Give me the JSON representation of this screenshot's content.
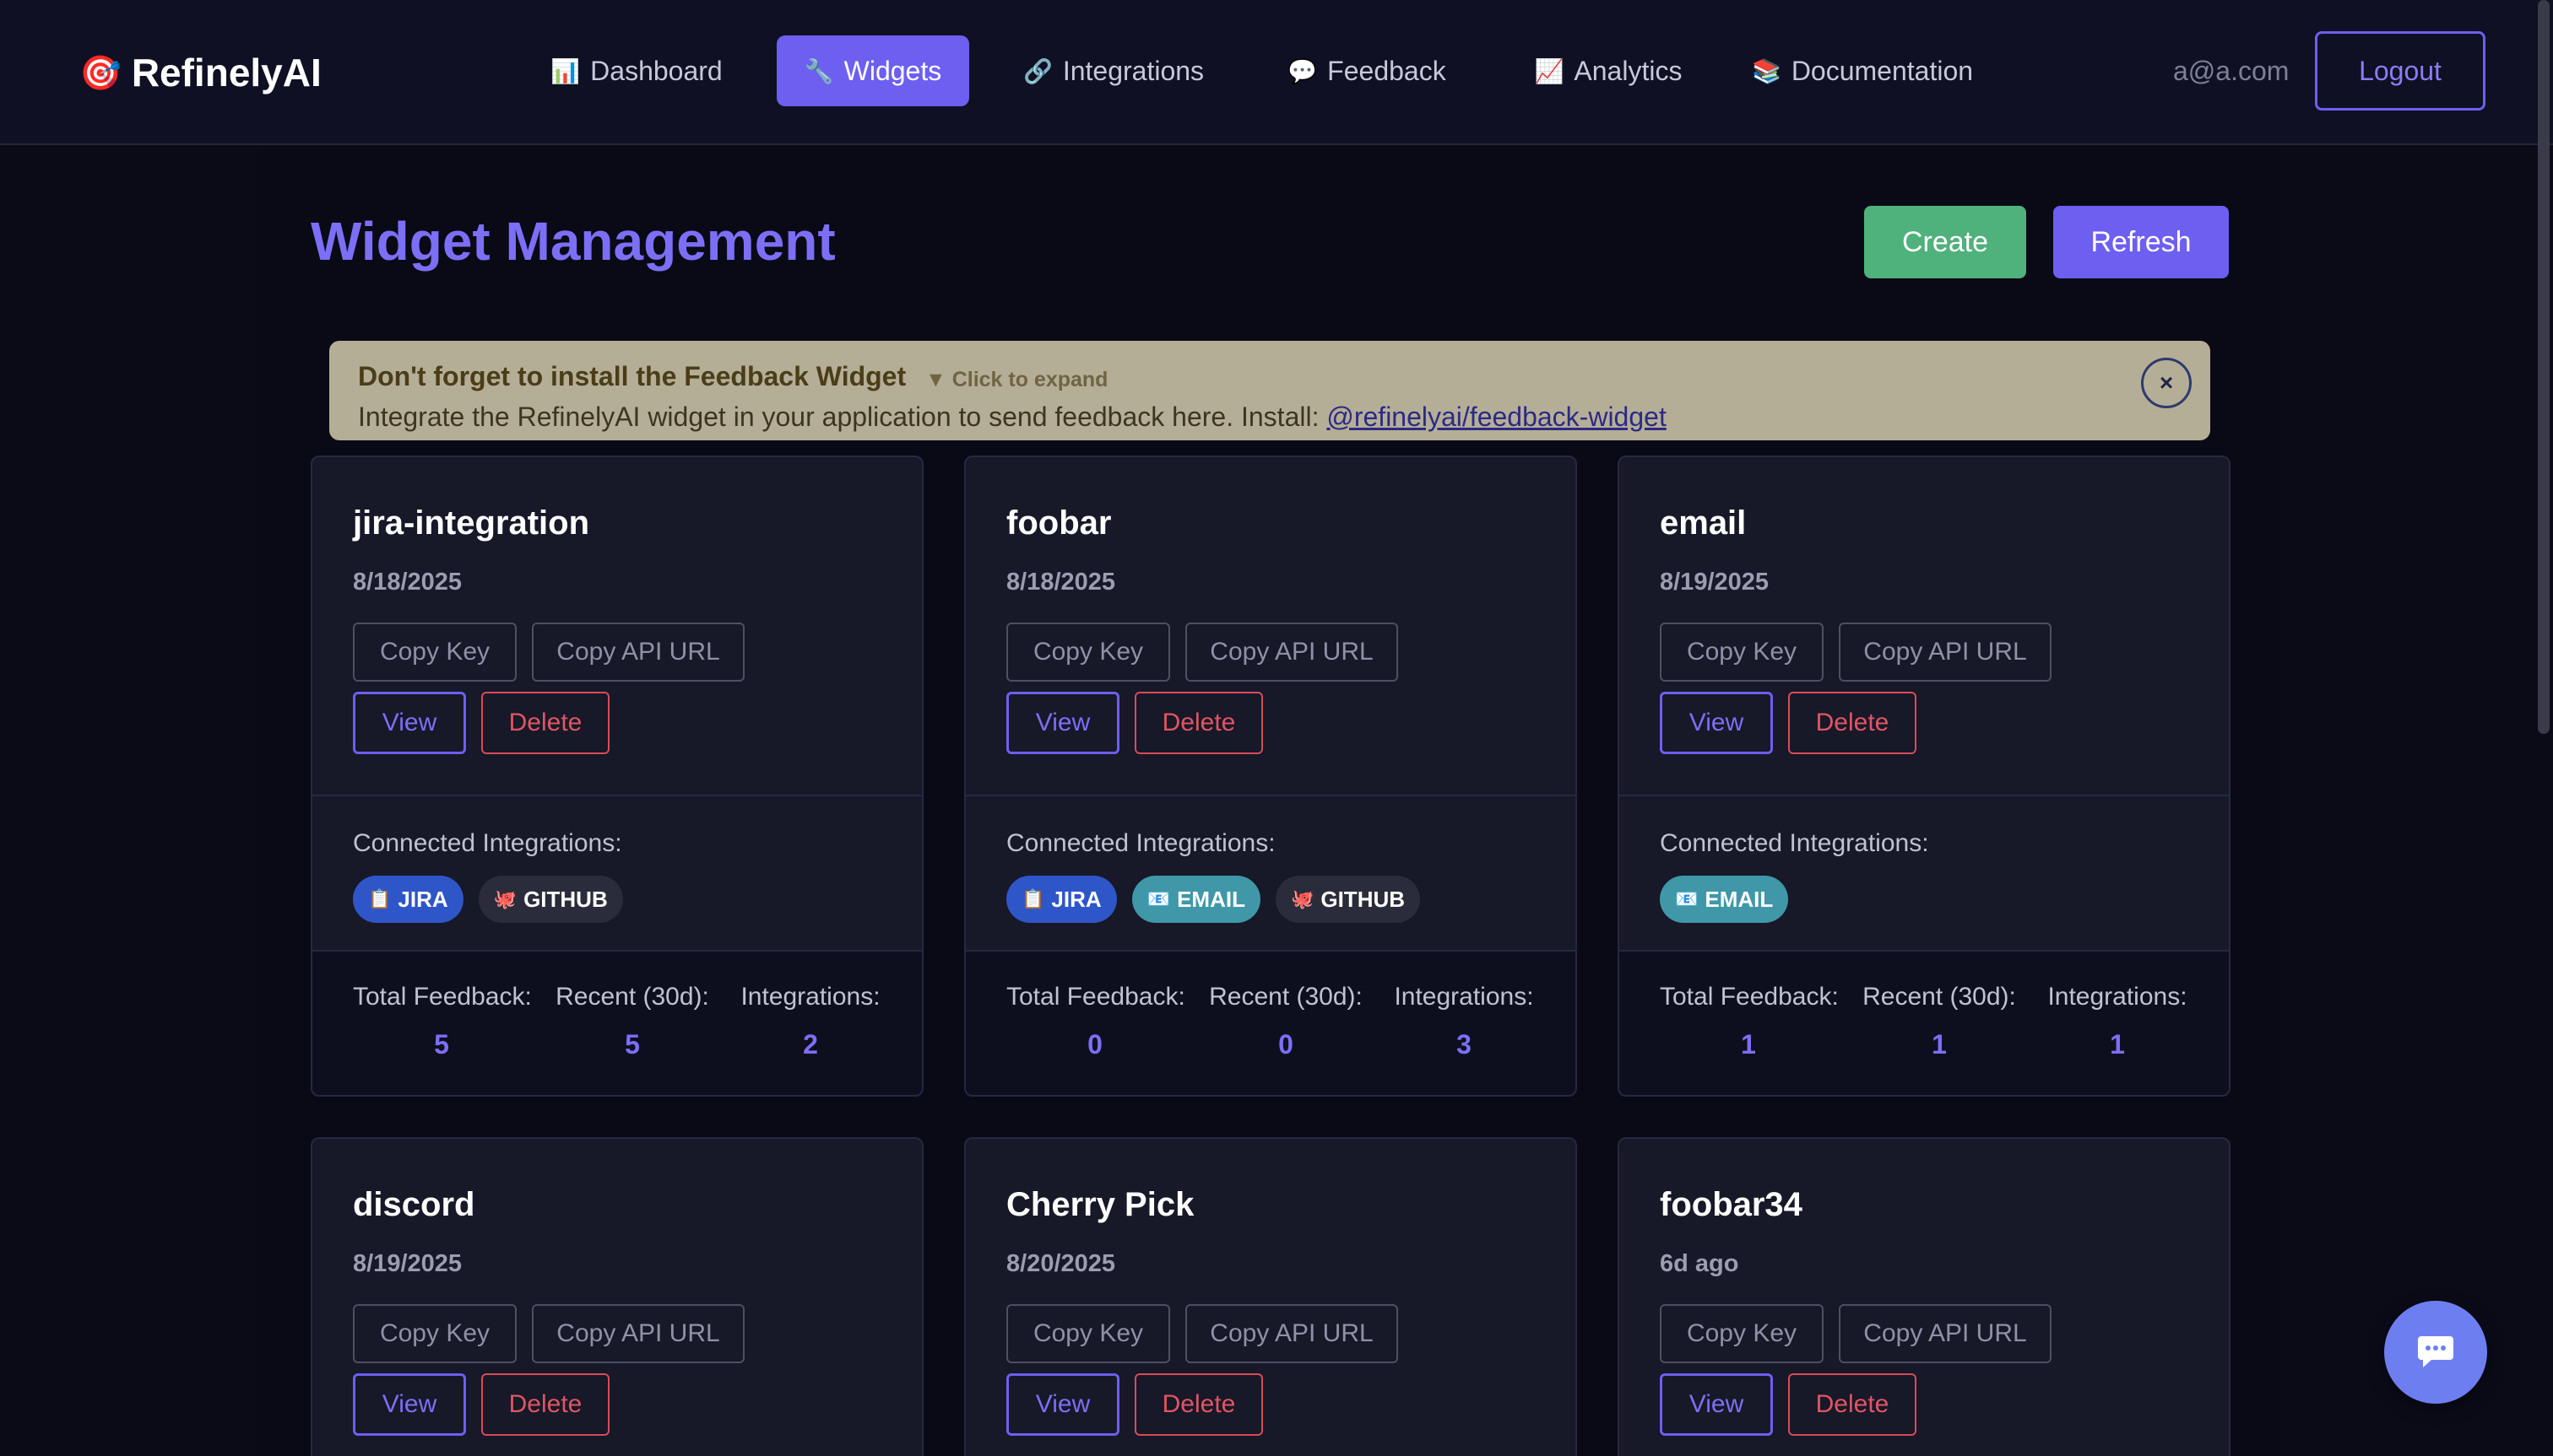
{
  "nav": {
    "brand": "RefinelyAI",
    "brand_icon": "🎯",
    "links": [
      {
        "icon": "📊",
        "label": "Dashboard",
        "active": false
      },
      {
        "icon": "🔧",
        "label": "Widgets",
        "active": true
      },
      {
        "icon": "🔗",
        "label": "Integrations",
        "active": false
      },
      {
        "icon": "💬",
        "label": "Feedback",
        "active": false
      },
      {
        "icon": "📈",
        "label": "Analytics",
        "active": false
      },
      {
        "icon": "📚",
        "label": "Documentation",
        "active": false
      }
    ],
    "user_email": "a@a.com",
    "logout_label": "Logout"
  },
  "page": {
    "title": "Widget Management",
    "create_label": "Create",
    "refresh_label": "Refresh"
  },
  "banner": {
    "title": "Don't forget to install the Feedback Widget",
    "expand_hint": "▼ Click to expand",
    "text": "Integrate the RefinelyAI widget in your application to send feedback here. Install: ",
    "link": "@refinelyai/feedback-widget",
    "close_symbol": "×"
  },
  "card_labels": {
    "copy_key": "Copy Key",
    "copy_api_url": "Copy API URL",
    "view": "View",
    "delete": "Delete",
    "connected_integrations": "Connected Integrations:",
    "total_feedback": "Total Feedback:",
    "recent": "Recent (30d):",
    "integrations": "Integrations:"
  },
  "widgets": [
    {
      "name": "jira-integration",
      "date": "8/18/2025",
      "chips": [
        {
          "type": "jira",
          "icon": "📋",
          "label": "JIRA"
        },
        {
          "type": "github",
          "icon": "🐙",
          "label": "GITHUB"
        }
      ],
      "total": "5",
      "recent": "5",
      "integrations": "2"
    },
    {
      "name": "foobar",
      "date": "8/18/2025",
      "chips": [
        {
          "type": "jira",
          "icon": "📋",
          "label": "JIRA"
        },
        {
          "type": "email",
          "icon": "📧",
          "label": "EMAIL"
        },
        {
          "type": "github",
          "icon": "🐙",
          "label": "GITHUB"
        }
      ],
      "total": "0",
      "recent": "0",
      "integrations": "3"
    },
    {
      "name": "email",
      "date": "8/19/2025",
      "chips": [
        {
          "type": "email",
          "icon": "📧",
          "label": "EMAIL"
        }
      ],
      "total": "1",
      "recent": "1",
      "integrations": "1"
    },
    {
      "name": "discord",
      "date": "8/19/2025"
    },
    {
      "name": "Cherry Pick",
      "date": "8/20/2025"
    },
    {
      "name": "foobar34",
      "date": "6d ago"
    }
  ],
  "colors": {
    "accent": "#6d5ff0",
    "create": "#4fb17c",
    "delete": "#d94b58",
    "jira": "#2e56c9",
    "email": "#3f97a8",
    "github": "#2b2c3b"
  },
  "icons": {
    "chat_fab": "chat-bubble-icon"
  }
}
